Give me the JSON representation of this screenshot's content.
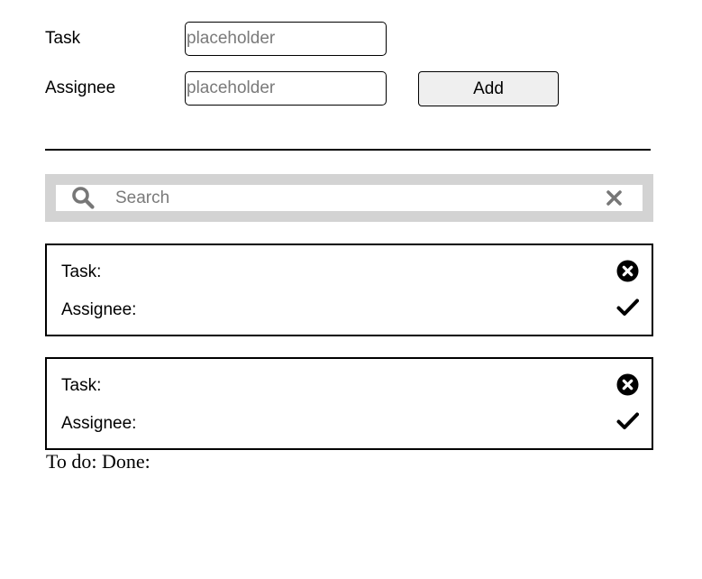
{
  "form": {
    "task_label": "Task",
    "task_placeholder": "placeholder",
    "task_value": "",
    "assignee_label": "Assignee",
    "assignee_placeholder": "placeholder",
    "assignee_value": "",
    "add_label": "Add"
  },
  "search": {
    "placeholder": "Search",
    "value": "",
    "search_icon": "search-icon",
    "clear_icon": "close-icon"
  },
  "tasks": [
    {
      "task_label": "Task:",
      "assignee_label": "Assignee:",
      "delete_icon": "times-circle-icon",
      "done_icon": "check-icon"
    },
    {
      "task_label": "Task:",
      "assignee_label": "Assignee:",
      "delete_icon": "times-circle-icon",
      "done_icon": "check-icon"
    }
  ],
  "summary": {
    "text": "To do: Done:"
  },
  "colors": {
    "search_bar_bg": "#d3d3d3",
    "button_bg": "#efefef",
    "icon_gray": "#777777",
    "placeholder_gray": "#7a7a7a"
  }
}
